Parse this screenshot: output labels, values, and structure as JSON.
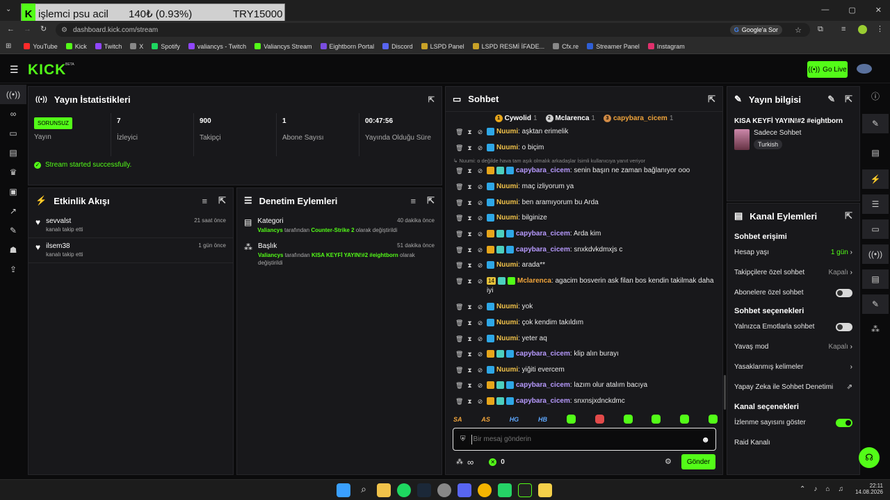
{
  "overlay": {
    "title": "işlemci psu acil",
    "amount": "140₺ (0.93%)",
    "goal": "TRY15000",
    "k": "K"
  },
  "browser": {
    "url": "dashboard.kick.com/stream",
    "google_btn": "Google'a Sor",
    "bookmarks": [
      {
        "label": "YouTube",
        "color": "#ff2a2a"
      },
      {
        "label": "Kick",
        "color": "#53fc18"
      },
      {
        "label": "Twitch",
        "color": "#9146ff"
      },
      {
        "label": "X",
        "color": "#888888"
      },
      {
        "label": "Spotify",
        "color": "#1ed760"
      },
      {
        "label": "valiancys - Twitch",
        "color": "#9146ff"
      },
      {
        "label": "Valiancys Stream",
        "color": "#53fc18"
      },
      {
        "label": "Eightborn Portal",
        "color": "#7a4de0"
      },
      {
        "label": "Discord",
        "color": "#5865f2"
      },
      {
        "label": "LSPD Panel",
        "color": "#c9a227"
      },
      {
        "label": "LSPD  RESMİ İFADE...",
        "color": "#c9a227"
      },
      {
        "label": "Cfx.re",
        "color": "#888888"
      },
      {
        "label": "Streamer Panel",
        "color": "#2f5fd6"
      },
      {
        "label": "Instagram",
        "color": "#e1306c"
      }
    ]
  },
  "header": {
    "logo": "KICK",
    "beta": "BETA",
    "go_live": "Go Live"
  },
  "stats": {
    "title": "Yayın İstatistikleri",
    "status_badge": "SORUNSUZ",
    "cells": [
      {
        "value": "",
        "label": "Yayın"
      },
      {
        "value": "7",
        "label": "İzleyici"
      },
      {
        "value": "900",
        "label": "Takipçi"
      },
      {
        "value": "1",
        "label": "Abone Sayısı"
      },
      {
        "value": "00:47:56",
        "label": "Yayında Olduğu Süre"
      }
    ],
    "success": "Stream started successfully."
  },
  "activity": {
    "title": "Etkinlik Akışı",
    "items": [
      {
        "name": "sevvalst",
        "desc": "kanalı takip etti",
        "time": "21 saat önce"
      },
      {
        "name": "ilsem38",
        "desc": "kanalı takip etti",
        "time": "1 gün önce"
      }
    ]
  },
  "moderation": {
    "title": "Denetim Eylemleri",
    "items": [
      {
        "title": "Kategori",
        "time": "40 dakika önce",
        "who": "Valiancys",
        "mid": " tarafından ",
        "what": "Counter-Strike 2",
        "end": " olarak değiştirildi"
      },
      {
        "title": "Başlık",
        "time": "51 dakika önce",
        "who": "Valiancys",
        "mid": " tarafından ",
        "what": "KISA KEYFİ YAYIN!#2 #eightborn",
        "end": " olarak değiştirildi"
      }
    ]
  },
  "chat": {
    "title": "Sohbet",
    "top": [
      {
        "rank": "1",
        "name": "Cywolid",
        "count": "1"
      },
      {
        "rank": "2",
        "name": "Mclarenca",
        "count": "1"
      },
      {
        "rank": "3",
        "name": "capybara_cicem",
        "count": "1"
      }
    ],
    "reply_note": "Nuumi: o değilde hava tam aşık olmalık arkadaşlar İsimli kullanıcıya yanıt veriyor",
    "messages": [
      {
        "user": "Nuumi",
        "cls": "u-nuumi",
        "text": "aşktan erimelik"
      },
      {
        "user": "Nuumi",
        "cls": "u-nuumi",
        "text": "o biçim"
      },
      {
        "user": "capybara_cicem",
        "cls": "u-capy",
        "text": "senin başın ne zaman bağlanıyor ooo"
      },
      {
        "user": "Nuumi",
        "cls": "u-nuumi",
        "text": "maç izliyorum ya"
      },
      {
        "user": "Nuumi",
        "cls": "u-nuumi",
        "text": "ben aramıyorum bu Arda"
      },
      {
        "user": "Nuumi",
        "cls": "u-nuumi",
        "text": "bilginize"
      },
      {
        "user": "capybara_cicem",
        "cls": "u-capy",
        "text": "Arda kim"
      },
      {
        "user": "capybara_cicem",
        "cls": "u-capy",
        "text": "snxkdvkdmxjs c"
      },
      {
        "user": "Nuumi",
        "cls": "u-nuumi",
        "text": "arada**"
      },
      {
        "user": "Mclarenca",
        "cls": "u-mcl",
        "text": "agacim bosverin ask filan bos kendin takilmak daha iyi",
        "sub": "14"
      },
      {
        "user": "Nuumi",
        "cls": "u-nuumi",
        "text": "yok"
      },
      {
        "user": "Nuumi",
        "cls": "u-nuumi",
        "text": "çok kendim takıldım"
      },
      {
        "user": "Nuumi",
        "cls": "u-nuumi",
        "text": "yeter aq"
      },
      {
        "user": "capybara_cicem",
        "cls": "u-capy",
        "text": "klip alın burayı"
      },
      {
        "user": "Nuumi",
        "cls": "u-nuumi",
        "text": "yiğiti evercem"
      },
      {
        "user": "capybara_cicem",
        "cls": "u-capy",
        "text": "lazım olur atalım bacıya"
      },
      {
        "user": "capybara_cicem",
        "cls": "u-capy",
        "text": "snxnsjxdnckdmc"
      }
    ],
    "emotes": [
      "SA",
      "AS",
      "HG",
      "HB"
    ],
    "input_placeholder": "Bir mesaj gönderin",
    "infinity": "∞",
    "points": "0",
    "send": "Gönder"
  },
  "stream_info": {
    "title": "Yayın bilgisi",
    "stream_title": "KISA KEYFİ YAYIN!#2 #eightborn",
    "category": "Sadece Sohbet",
    "tag": "Turkish"
  },
  "channel_actions": {
    "title": "Kanal Eylemleri",
    "chat_access": "Sohbet erişimi",
    "account_age": "Hesap yaşı",
    "account_age_val": "1 gün",
    "followers_only": "Takipçilere özel sohbet",
    "followers_only_val": "Kapalı",
    "subs_only": "Abonelere özel sohbet",
    "chat_options": "Sohbet seçenekleri",
    "emote_only": "Yalnızca Emotlarla sohbet",
    "slow": "Yavaş mod",
    "slow_val": "Kapalı",
    "banned_words": "Yasaklanmış kelimeler",
    "ai_mod": "Yapay Zeka ile Sohbet Denetimi",
    "channel_options": "Kanal seçenekleri",
    "view_count": "İzlenme sayısını göster",
    "raid": "Raid Kanalı"
  },
  "taskbar": {
    "time": "22:11",
    "date": "14.08.2026"
  }
}
